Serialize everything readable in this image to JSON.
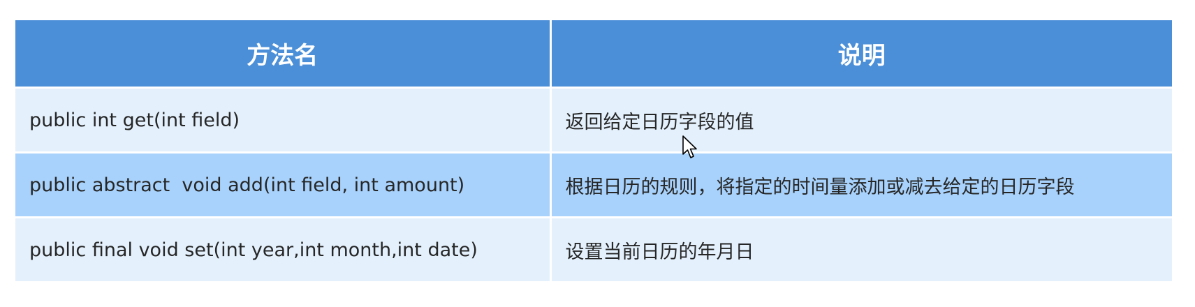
{
  "table": {
    "headers": [
      "方法名",
      "说明"
    ],
    "rows": [
      {
        "method": "public int get(int field)",
        "description": "返回给定日历字段的值"
      },
      {
        "method": "public abstract  void add(int field, int amount)",
        "description": "根据日历的规则，将指定的时间量添加或减去给定的日历字段"
      },
      {
        "method": "public final void set(int year,int month,int date)",
        "description": "设置当前日历的年月日"
      }
    ]
  },
  "colors": {
    "header_background": "#4b8fd8",
    "row_light": "#e4f1fd",
    "row_mid": "#a8d2fb",
    "header_text": "#ffffff",
    "body_text": "#262626"
  },
  "cursor_icon": "arrow-cursor"
}
